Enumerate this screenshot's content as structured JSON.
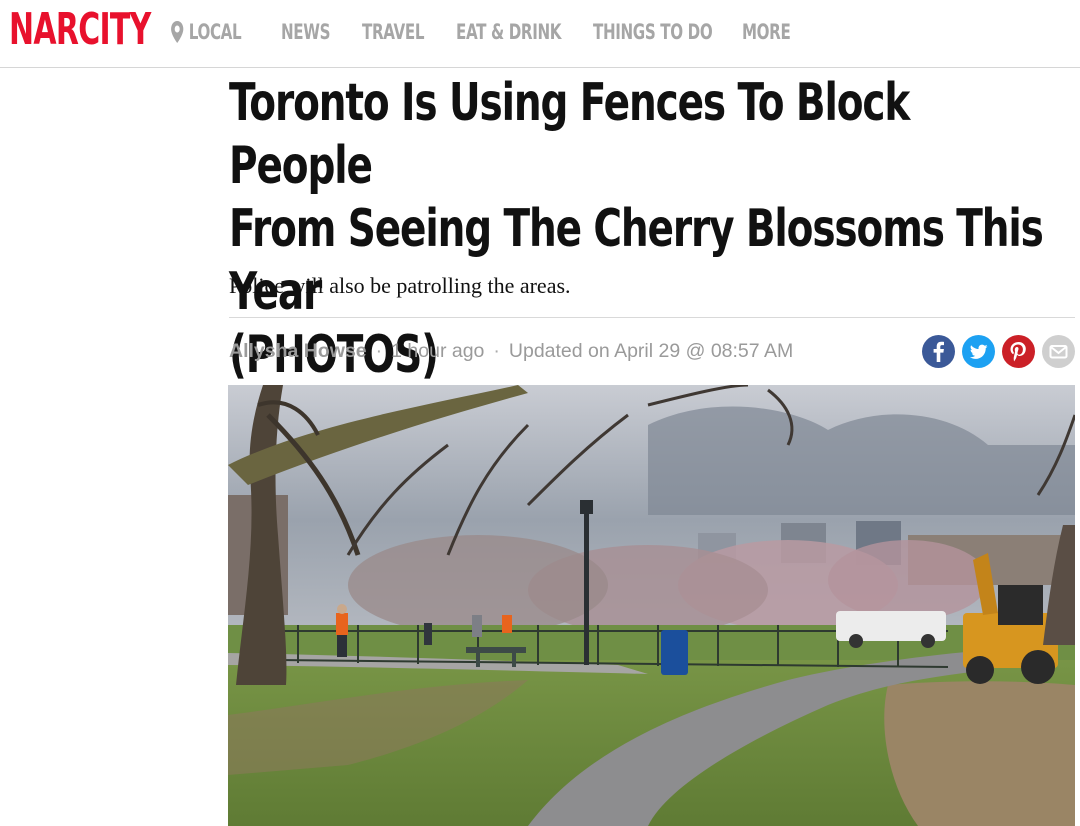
{
  "site": {
    "logo_text": "NARCITY",
    "brand_color": "#e8112d"
  },
  "nav": {
    "items": [
      {
        "label": "LOCAL",
        "icon": "location-pin-icon"
      },
      {
        "label": "NEWS"
      },
      {
        "label": "TRAVEL"
      },
      {
        "label": "EAT & DRINK"
      },
      {
        "label": "THINGS TO DO"
      },
      {
        "label": "MORE"
      }
    ]
  },
  "article": {
    "headline_lines": [
      "Toronto Is Using Fences To Block People",
      "From Seeing The Cherry Blossoms This Year",
      "(PHOTOS)"
    ],
    "subheadline": "Police will also be patrolling the areas.",
    "author": "Allysha Howse",
    "time_ago": "1 hour ago",
    "updated": "Updated on April 29 @ 08:57 AM",
    "separator": "·"
  },
  "share": {
    "buttons": [
      {
        "name": "facebook-share-button",
        "icon": "facebook-icon",
        "color": "#3b5998"
      },
      {
        "name": "twitter-share-button",
        "icon": "twitter-icon",
        "color": "#1da1f2"
      },
      {
        "name": "pinterest-share-button",
        "icon": "pinterest-icon",
        "color": "#cb2027"
      },
      {
        "name": "email-share-button",
        "icon": "email-icon",
        "color": "#cfcfcf"
      }
    ]
  },
  "hero_image": {
    "subject": "fenced park with cherry blossom trees, path, workers and a backhoe"
  }
}
